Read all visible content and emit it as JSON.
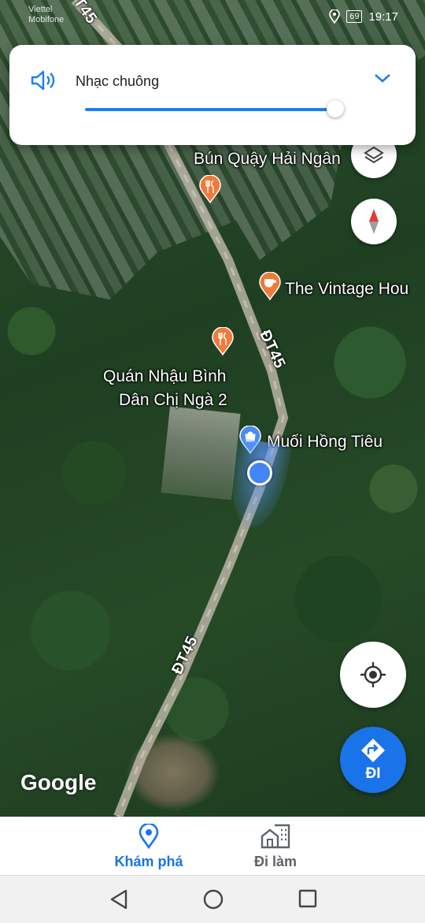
{
  "status_bar": {
    "carrier_line1": "Viettel",
    "carrier_line2": "Mobifone",
    "battery": "69",
    "time": "19:17"
  },
  "volume_panel": {
    "title": "Nhạc chuông",
    "level": 0.98,
    "accent_color": "#1a7ff0"
  },
  "map": {
    "roads": [
      {
        "label": "ĐT45"
      },
      {
        "label": "ĐT45"
      },
      {
        "label": "ĐT45"
      }
    ],
    "places": [
      {
        "name": "Bún Quậy Hải Ngân",
        "icon": "restaurant-icon"
      },
      {
        "name": "The Vintage Hou",
        "icon": "cafe-icon"
      },
      {
        "name_line1": "Quán Nhậu Bình",
        "name_line2": "Dân Chị Ngà 2",
        "icon": "restaurant-icon"
      },
      {
        "name": "Muối Hồng Tiêu",
        "icon": "shopping-icon"
      }
    ],
    "logo": "Google"
  },
  "buttons": {
    "layers_icon": "layers-icon",
    "compass_icon": "compass-icon",
    "my_location_icon": "my-location-icon",
    "go_label": "ĐI"
  },
  "bottom_nav": {
    "tabs": [
      {
        "label": "Khám phá",
        "icon": "explore-pin-icon",
        "active": true
      },
      {
        "label": "Đi làm",
        "icon": "commute-icon",
        "active": false
      }
    ]
  },
  "colors": {
    "brand_blue": "#1a73e8",
    "restaurant_pin": "#f07a3a",
    "shop_pin": "#4a8af4"
  }
}
